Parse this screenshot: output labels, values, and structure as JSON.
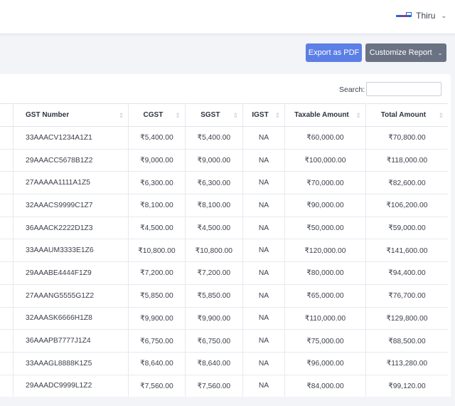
{
  "header": {
    "user_name": "Thiru",
    "user_chevron": "⌄"
  },
  "toolbar": {
    "export_label": "Export as PDF",
    "customize_label": "Customize Report",
    "customize_caret": "⌄"
  },
  "search": {
    "label": "Search:",
    "value": "",
    "placeholder": ""
  },
  "table": {
    "columns": [
      "GST Number",
      "CGST",
      "SGST",
      "IGST",
      "Taxable Amount",
      "Total Amount"
    ],
    "rows": [
      [
        "33AAACV1234A1Z1",
        "₹5,400.00",
        "₹5,400.00",
        "NA",
        "₹60,000.00",
        "₹70,800.00"
      ],
      [
        "29AAACC5678B1Z2",
        "₹9,000.00",
        "₹9,000.00",
        "NA",
        "₹100,000.00",
        "₹118,000.00"
      ],
      [
        "27AAAAA1111A1Z5",
        "₹6,300.00",
        "₹6,300.00",
        "NA",
        "₹70,000.00",
        "₹82,600.00"
      ],
      [
        "32AAACS9999C1Z7",
        "₹8,100.00",
        "₹8,100.00",
        "NA",
        "₹90,000.00",
        "₹106,200.00"
      ],
      [
        "36AAACK2222D1Z3",
        "₹4,500.00",
        "₹4,500.00",
        "NA",
        "₹50,000.00",
        "₹59,000.00"
      ],
      [
        "33AAAUM3333E1Z6",
        "₹10,800.00",
        "₹10,800.00",
        "NA",
        "₹120,000.00",
        "₹141,600.00"
      ],
      [
        "29AAABE4444F1Z9",
        "₹7,200.00",
        "₹7,200.00",
        "NA",
        "₹80,000.00",
        "₹94,400.00"
      ],
      [
        "27AAANG5555G1Z2",
        "₹5,850.00",
        "₹5,850.00",
        "NA",
        "₹65,000.00",
        "₹76,700.00"
      ],
      [
        "32AAASK6666H1Z8",
        "₹9,900.00",
        "₹9,900.00",
        "NA",
        "₹110,000.00",
        "₹129,800.00"
      ],
      [
        "36AAAPB7777J1Z4",
        "₹6,750.00",
        "₹6,750.00",
        "NA",
        "₹75,000.00",
        "₹88,500.00"
      ],
      [
        "33AAAGL8888K1Z5",
        "₹8,640.00",
        "₹8,640.00",
        "NA",
        "₹96,000.00",
        "₹113,280.00"
      ],
      [
        "29AAADC9999L1Z2",
        "₹7,560.00",
        "₹7,560.00",
        "NA",
        "₹84,000.00",
        "₹99,120.00"
      ]
    ]
  },
  "colors": {
    "export_button": "#5c7fe6",
    "customize_button": "#6a7283",
    "page_background": "#f3f4f8"
  },
  "icons": {
    "sort": "sort-icon",
    "logo": "brand-logo-icon"
  }
}
